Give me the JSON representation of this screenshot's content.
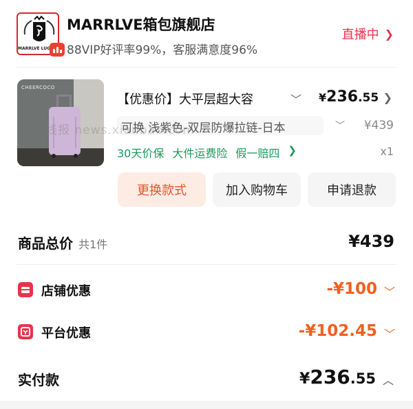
{
  "store": {
    "name": "MARRLVE箱包旗舰店",
    "stats": "88VIP好评率99%，客服满意度96%",
    "logo_text": "MARRLVE LUGGAGE",
    "live_label": "直播中"
  },
  "product": {
    "image_brand": "CHEERCOCO",
    "title": "【优惠价】大平层超大容",
    "price_int": "236",
    "price_dec": ".55",
    "spec": "可换  浅紫色-双层防爆拉链-日本",
    "watermark": "线报  news.xianbao.com",
    "original_price": "¥439",
    "service_tags": [
      "30天价保",
      "大件运费险",
      "假一赔四"
    ],
    "quantity": "x1"
  },
  "actions": {
    "change_label": "更换款式",
    "cart_label": "加入购物车",
    "refund_label": "申请退款"
  },
  "summary": {
    "total_label": "商品总价",
    "total_count": "共1件",
    "total_value": "¥439",
    "store_discount_label": "店铺优惠",
    "store_discount_value": "-¥100",
    "platform_discount_label": "平台优惠",
    "platform_discount_value": "-¥102.45",
    "paid_label": "实付款",
    "paid_int": "236",
    "paid_dec": ".55"
  },
  "currency_symbol": "¥",
  "colors": {
    "accent_red": "#e8334a",
    "discount_orange": "#f06020",
    "service_green": "#1a9a5c",
    "change_btn_bg": "#fdece4"
  }
}
